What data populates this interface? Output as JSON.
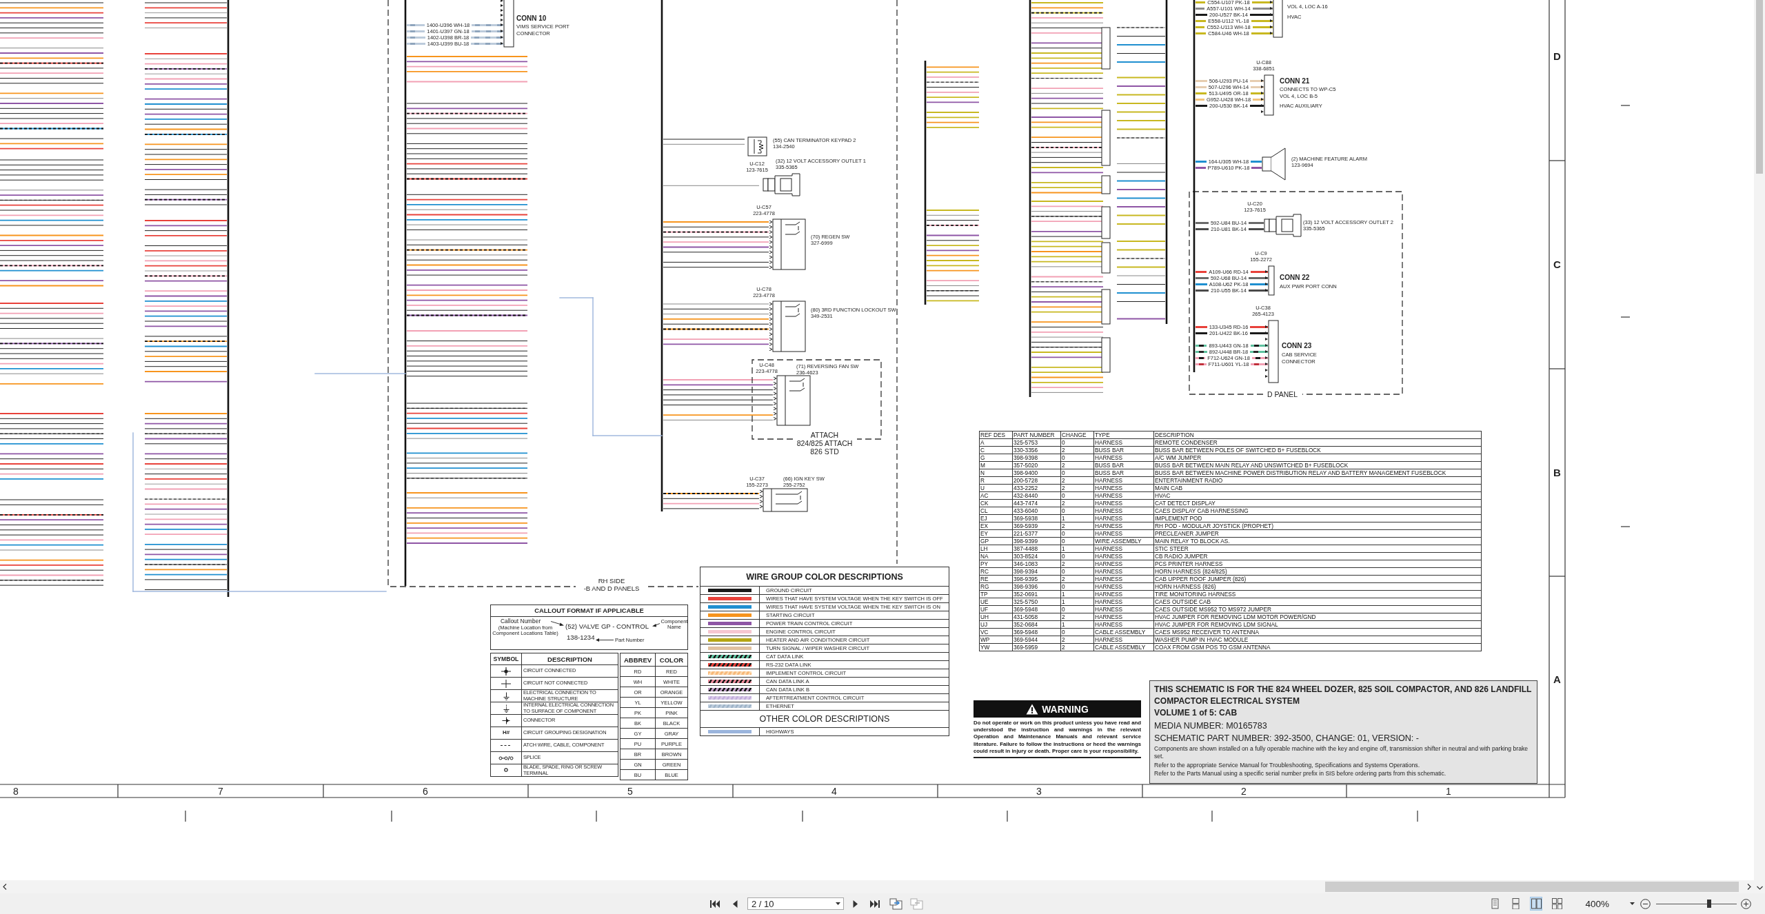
{
  "viewer": {
    "page_field": "2 / 10",
    "zoom_field": "400%",
    "zoom_slider": {
      "level": 0.66
    },
    "layout_modes": [
      {
        "selected": false
      },
      {
        "selected": false
      },
      {
        "selected": true
      },
      {
        "selected": false
      }
    ]
  },
  "sheet": {
    "zone_columns": [
      "8",
      "7",
      "6",
      "5",
      "4",
      "3",
      "2",
      "1"
    ],
    "zone_rows": [
      "D",
      "C",
      "B",
      "A"
    ],
    "area_labels": [
      {
        "kind": "rh-side",
        "lines": [
          "RH SIDE",
          "-B AND D PANELS"
        ]
      },
      {
        "kind": "attach",
        "lines": [
          "ATTACH",
          "824/825 ATTACH",
          "826 STD"
        ]
      },
      {
        "kind": "d-panel",
        "lines": [
          "D PANEL"
        ]
      }
    ],
    "devices": [
      {
        "kind": "connector",
        "title": "CONN 10",
        "notes": [
          "VIMS SERVICE PORT",
          "CONNECTOR"
        ],
        "wires": [
          {
            "label": "1400-U396 WH-18",
            "color": "#bccbdb",
            "stripe": {
              "color": "#8fa5bd"
            }
          },
          {
            "label": "1401-U397 GN-18",
            "color": "#bccbdb",
            "stripe": {
              "color": "#8fa5bd"
            }
          },
          {
            "label": "1402-U398 BR-18",
            "color": "#bccbdb",
            "stripe": {
              "color": "#8fa5bd"
            }
          },
          {
            "label": "1403-U399 BU-18",
            "color": "#bccbdb",
            "stripe": {
              "color": "#8fa5bd"
            }
          }
        ]
      },
      {
        "kind": "terminator",
        "name": "(55) CAN TERMINATOR KEYPAD 2",
        "name_part": "134-2540"
      },
      {
        "kind": "outlet",
        "ref": "U-C12",
        "part": "123-7615",
        "name": "(32) 12 VOLT ACCESSORY OUTLET 1",
        "name_part": "335-5365"
      },
      {
        "kind": "switch",
        "ref": "U-C57",
        "part": "223-4778",
        "name": "(70) REGEN SW",
        "name_part": "327-6999"
      },
      {
        "kind": "switch",
        "ref": "U-C78",
        "part": "223-4778",
        "name": "(80) 3RD FUNCTION LOCKOUT SW",
        "name_part": "349-2531"
      },
      {
        "kind": "switch",
        "ref": "U-C48",
        "part": "223-4778",
        "name": "(71) REVERSING FAN SW",
        "name_part": "236-4623"
      },
      {
        "kind": "switch",
        "ref": "U-C37",
        "part": "155-2273",
        "name": "(66) IGN KEY SW",
        "name_part": "255-2752"
      },
      {
        "kind": "connector",
        "notes": [
          "VOL 4, LOC A-16",
          "HVAC"
        ],
        "wires": [
          {
            "label": "C554-U107 PK-18",
            "color": "#c8b820"
          },
          {
            "label": "A557-U101 WH-14",
            "color": "#8a8a8a"
          },
          {
            "label": "200-U527 BK-14",
            "color": "#1a1a1a"
          },
          {
            "label": "E558-U112 YL-18",
            "color": "#c8b820"
          },
          {
            "label": "C552-U113 WH-18",
            "color": "#c8b820"
          },
          {
            "label": "C584-U46 WH-18",
            "color": "#c8b820"
          }
        ]
      },
      {
        "kind": "connector",
        "ref": "U-C88",
        "part": "338-6851",
        "title": "CONN 21",
        "notes": [
          "CONNECTS TO WP-C5",
          "VOL 4, LOC B-5",
          "HVAC AUXILIARY"
        ],
        "wires": [
          {
            "label": "506-U293 PU-14",
            "color": "#e6cdb0"
          },
          {
            "label": "507-U296 WH-14",
            "color": "#e6cdb0"
          },
          {
            "label": "513-U495 OR-18",
            "color": "#c8b820"
          },
          {
            "label": "G952-U428 WH-18",
            "color": "#f2c47e"
          },
          {
            "label": "200-U530 BK-14",
            "color": "#1a1a1a"
          }
        ]
      },
      {
        "kind": "speaker",
        "name": "(2) MACHINE FEATURE ALARM",
        "name_part": "123-9694",
        "wires": [
          {
            "label": "164-U305 WH-18",
            "color": "#1e8fd0"
          },
          {
            "label": "P789-U610 PK-18",
            "color": "#8e55a5"
          }
        ]
      },
      {
        "kind": "outlet",
        "ref": "U-C20",
        "part": "123-7615",
        "name": "(33) 12 VOLT ACCESSORY OUTLET 2",
        "name_part": "335-5365",
        "wires": [
          {
            "label": "592-U84 BU-14",
            "color": "#6a6a6a"
          },
          {
            "label": "210-U81 BK-14",
            "color": "#4a4a4a"
          }
        ]
      },
      {
        "kind": "connector",
        "ref": "U-C9",
        "part": "155-2272",
        "title": "CONN 22",
        "notes": [
          "AUX PWR PORT CONN"
        ],
        "wires": [
          {
            "label": "A109-U66 RD-14",
            "color": "#e8413a"
          },
          {
            "label": "592-U68 BU-14",
            "color": "#6a6a6a"
          },
          {
            "label": "A108-U62 PK-18",
            "color": "#1e8fd0"
          },
          {
            "label": "210-U55 BK-14",
            "color": "#4a4a4a"
          }
        ]
      },
      {
        "kind": "connector",
        "ref": "U-C38",
        "part": "265-4123",
        "title": "CONN 23",
        "notes": [
          "CAB SERVICE",
          "CONNECTOR"
        ],
        "wires": [
          {
            "label": "133-U345 RD-16",
            "color": "#e8413a"
          },
          {
            "label": "201-U422 BK-16",
            "color": "#1a1a1a"
          },
          {
            "label": "893-U443 GN-18",
            "color": "#5fc2a0",
            "stripe": {
              "color": "#1a1a1a"
            }
          },
          {
            "label": "892-U448 BR-18",
            "color": "#5fc2a0",
            "stripe": {
              "color": "#2a2a2a"
            }
          },
          {
            "label": "F712-U624 GN-18",
            "color": "#f2a0b4",
            "stripe": {
              "color": "#1a1a1a"
            }
          },
          {
            "label": "F711-U601 YL-18",
            "color": "#f2a0b4",
            "stripe": {
              "color": "#c0303a"
            }
          }
        ]
      }
    ]
  },
  "part_table": {
    "columns": [
      "REF DES",
      "PART NUMBER",
      "CHANGE",
      "TYPE",
      "DESCRIPTION"
    ],
    "rows": [
      [
        "A",
        "325-5753",
        "0",
        "HARNESS",
        "REMOTE CONDENSER"
      ],
      [
        "C",
        "330-3356",
        "2",
        "BUSS BAR",
        "BUSS BAR BETWEEN POLES OF SWITCHED B+ FUSEBLOCK"
      ],
      [
        "G",
        "398-9398",
        "0",
        "HARNESS",
        "A/C WM JUMPER"
      ],
      [
        "M",
        "357-5020",
        "2",
        "BUSS BAR",
        "BUSS BAR BETWEEN MAIN RELAY AND UNSWITCHED B+ FUSEBLOCK"
      ],
      [
        "N",
        "398-9400",
        "0",
        "BUSS BAR",
        "BUSS BAR BETWEEN MACHINE POWER DISTRIBUTION RELAY AND BATTERY MANAGEMENT FUSEBLOCK"
      ],
      [
        "R",
        "200-5728",
        "2",
        "HARNESS",
        "ENTERTAINMENT RADIO"
      ],
      [
        "U",
        "433-2252",
        "2",
        "HARNESS",
        "MAIN CAB"
      ],
      [
        "AC",
        "432-8440",
        "0",
        "HARNESS",
        "HVAC"
      ],
      [
        "CK",
        "443-7474",
        "2",
        "HARNESS",
        "CAT DETECT DISPLAY"
      ],
      [
        "CL",
        "433-6040",
        "0",
        "HARNESS",
        "CAES DISPLAY CAB HARNESSING"
      ],
      [
        "EJ",
        "369-5938",
        "1",
        "HARNESS",
        "IMPLEMENT POD"
      ],
      [
        "EX",
        "369-5939",
        "2",
        "HARNESS",
        "RH POD - MODULAR JOYSTICK (PROPHET)"
      ],
      [
        "EY",
        "221-5377",
        "0",
        "HARNESS",
        "PRECLEANER JUMPER"
      ],
      [
        "GP",
        "398-9399",
        "0",
        "WIRE ASSEMBLY",
        "MAIN RELAY TO BLOCK AS."
      ],
      [
        "LH",
        "387-4488",
        "1",
        "HARNESS",
        "STIC STEER"
      ],
      [
        "NA",
        "303-8524",
        "0",
        "HARNESS",
        "CB RADIO JUMPER"
      ],
      [
        "PY",
        "346-1083",
        "2",
        "HARNESS",
        "PCS PRINTER HARNESS"
      ],
      [
        "RC",
        "398-9394",
        "0",
        "HARNESS",
        "HORN HARNESS (824/825)"
      ],
      [
        "RE",
        "398-9395",
        "2",
        "HARNESS",
        "CAB UPPER ROOF JUMPER (826)"
      ],
      [
        "RG",
        "398-9396",
        "0",
        "HARNESS",
        "HORN HARNESS (826)"
      ],
      [
        "TP",
        "352-0691",
        "1",
        "HARNESS",
        "TIRE MONITORING HARNESS"
      ],
      [
        "UE",
        "325-5750",
        "1",
        "HARNESS",
        "CAES OUTSIDE CAB"
      ],
      [
        "UF",
        "369-5948",
        "0",
        "HARNESS",
        "CAES OUTSIDE MS952 TO MS972 JUMPER"
      ],
      [
        "UH",
        "431-5058",
        "2",
        "HARNESS",
        "HVAC JUMPER FOR REMOVING LDM MOTOR POWER/GND"
      ],
      [
        "UJ",
        "352-0684",
        "1",
        "HARNESS",
        "HVAC JUMPER FOR REMOVING LDM SIGNAL"
      ],
      [
        "VC",
        "369-5948",
        "0",
        "CABLE ASSEMBLY",
        "CAES MS952 RECEIVER TO ANTENNA"
      ],
      [
        "WP",
        "369-5944",
        "2",
        "HARNESS",
        "WASHER PUMP IN HVAC MODULE"
      ],
      [
        "YW",
        "369-5959",
        "2",
        "CABLE ASSEMBLY",
        "COAX FROM GSM POS TO GSM ANTENNA"
      ]
    ]
  },
  "wire_legend": {
    "title": "WIRE GROUP COLOR DESCRIPTIONS",
    "items": [
      {
        "kind": "solid",
        "label": "GROUND CIRCUIT",
        "color": "#1a1a1a"
      },
      {
        "kind": "solid",
        "label": "WIRES THAT HAVE SYSTEM VOLTAGE WHEN THE KEY SWITCH IS OFF",
        "color": "#e8413a"
      },
      {
        "kind": "solid",
        "label": "WIRES THAT HAVE SYSTEM VOLTAGE WHEN THE KEY SWITCH IS ON",
        "color": "#1e8fd0"
      },
      {
        "kind": "solid",
        "label": "STARTING CIRCUIT",
        "color": "#f7941d"
      },
      {
        "kind": "solid",
        "label": "POWER TRAIN CONTROL CIRCUIT",
        "color": "#8e55a5"
      },
      {
        "kind": "solid",
        "label": "ENGINE CONTROL CIRCUIT",
        "color": "#f6c6d0"
      },
      {
        "kind": "solid",
        "label": "HEATER AND AIR CONDITIONER CIRCUIT",
        "color": "#b5a514"
      },
      {
        "kind": "solid",
        "label": "TURN SIGNAL / WIPER WASHER CIRCUIT",
        "color": "#e0c0a0"
      },
      {
        "kind": "striped",
        "label": "CAT DATA LINK",
        "color": "#5fc2a0",
        "stripe": {
          "color": "#1a1a1a"
        }
      },
      {
        "kind": "striped",
        "label": "RS-232 DATA LINK",
        "color": "#e8413a",
        "stripe": {
          "color": "#1a1a1a"
        }
      },
      {
        "kind": "striped",
        "label": "IMPLEMENT CONTROL CIRCUIT",
        "color": "#f7b97a",
        "stripe": {
          "color": "#fbd9b0"
        }
      },
      {
        "kind": "striped",
        "label": "CAN DATA LINK A",
        "color": "#e88a9a",
        "stripe": {
          "color": "#1a1a1a"
        }
      },
      {
        "kind": "striped",
        "label": "CAN DATA LINK B",
        "color": "#c0a0c8",
        "stripe": {
          "color": "#1a1a1a"
        }
      },
      {
        "kind": "striped",
        "label": "AFTERTREATMENT CONTROL CIRCUIT",
        "color": "#d8c8e8",
        "stripe": {
          "color": "#c2aedc"
        }
      },
      {
        "kind": "striped",
        "label": "ETHERNET",
        "color": "#bccbdb",
        "stripe": {
          "color": "#9fb4c8"
        }
      }
    ],
    "other_title": "OTHER COLOR DESCRIPTIONS",
    "other_items": [
      {
        "kind": "solid",
        "label": "HIGHWAYS",
        "color": "#9ab4dc"
      }
    ]
  },
  "callout": {
    "title": "CALLOUT FORMAT IF APPLICABLE",
    "callout_number": "Callout Number",
    "callout_source": "(Machine Location from Component Locations Table)",
    "example_name": "(52) VALVE GP - CONTROL",
    "example_part": "138-1234",
    "part_note": "Part Number",
    "name_note": "Component Name"
  },
  "symbols": {
    "columns": [
      "SYMBOL",
      "DESCRIPTION"
    ],
    "rows": [
      {
        "kind": "junction",
        "description": "CIRCUIT CONNECTED"
      },
      {
        "kind": "crossing",
        "description": "CIRCUIT NOT CONNECTED"
      },
      {
        "kind": "ground",
        "description": "ELECTRICAL CONNECTION TO MACHINE STRUCTURE"
      },
      {
        "kind": "internal-ground",
        "description": "INTERNAL ELECTRICAL CONNECTION TO SURFACE OF COMPONENT"
      },
      {
        "kind": "connector",
        "description": "CONNECTOR"
      },
      {
        "kind": "text",
        "symbol": "H#",
        "description": "CIRCUIT GROUPING DESIGNATION"
      },
      {
        "kind": "dashed",
        "description": "ATCH WIRE, CABLE, COMPONENT"
      },
      {
        "kind": "splice",
        "description": "SPLICE"
      },
      {
        "kind": "terminal",
        "description": "BLADE, SPADE, RING OR SCREW TERMINAL"
      }
    ]
  },
  "abbreviations": {
    "columns": [
      "ABBREV",
      "COLOR"
    ],
    "rows": [
      [
        "RD",
        "RED"
      ],
      [
        "WH",
        "WHITE"
      ],
      [
        "OR",
        "ORANGE"
      ],
      [
        "YL",
        "YELLOW"
      ],
      [
        "PK",
        "PINK"
      ],
      [
        "BK",
        "BLACK"
      ],
      [
        "GY",
        "GRAY"
      ],
      [
        "PU",
        "PURPLE"
      ],
      [
        "BR",
        "BROWN"
      ],
      [
        "GN",
        "GREEN"
      ],
      [
        "BU",
        "BLUE"
      ]
    ]
  },
  "warning": {
    "title": "WARNING",
    "text": "Do not operate or work on this product unless you have read and understood the instruction and warnings in the relevant Operation and Maintenance Manuals and relevant service literature. Failure to follow the instructions or heed the warnings could result in injury or death. Proper care is your responsibility."
  },
  "title_block": {
    "heading": "THIS SCHEMATIC IS FOR THE 824 WHEEL DOZER, 825 SOIL COMPACTOR, AND 826 LANDFILL COMPACTOR ELECTRICAL SYSTEM",
    "volume": "VOLUME 1 of 5: CAB",
    "media": "MEDIA NUMBER: M0165783",
    "part_number": "SCHEMATIC PART NUMBER: 392-3500, CHANGE: 01, VERSION: -",
    "notes": [
      "Components are shown installed on a fully operable machine with the key and engine off, transmission shifter in neutral and with parking brake set.",
      "Refer to the appropriate Service Manual for Troubleshooting, Specifications and Systems Operations.",
      "Refer to the Parts Manual using a specific serial number prefix in SIS before ordering parts from this schematic."
    ]
  }
}
